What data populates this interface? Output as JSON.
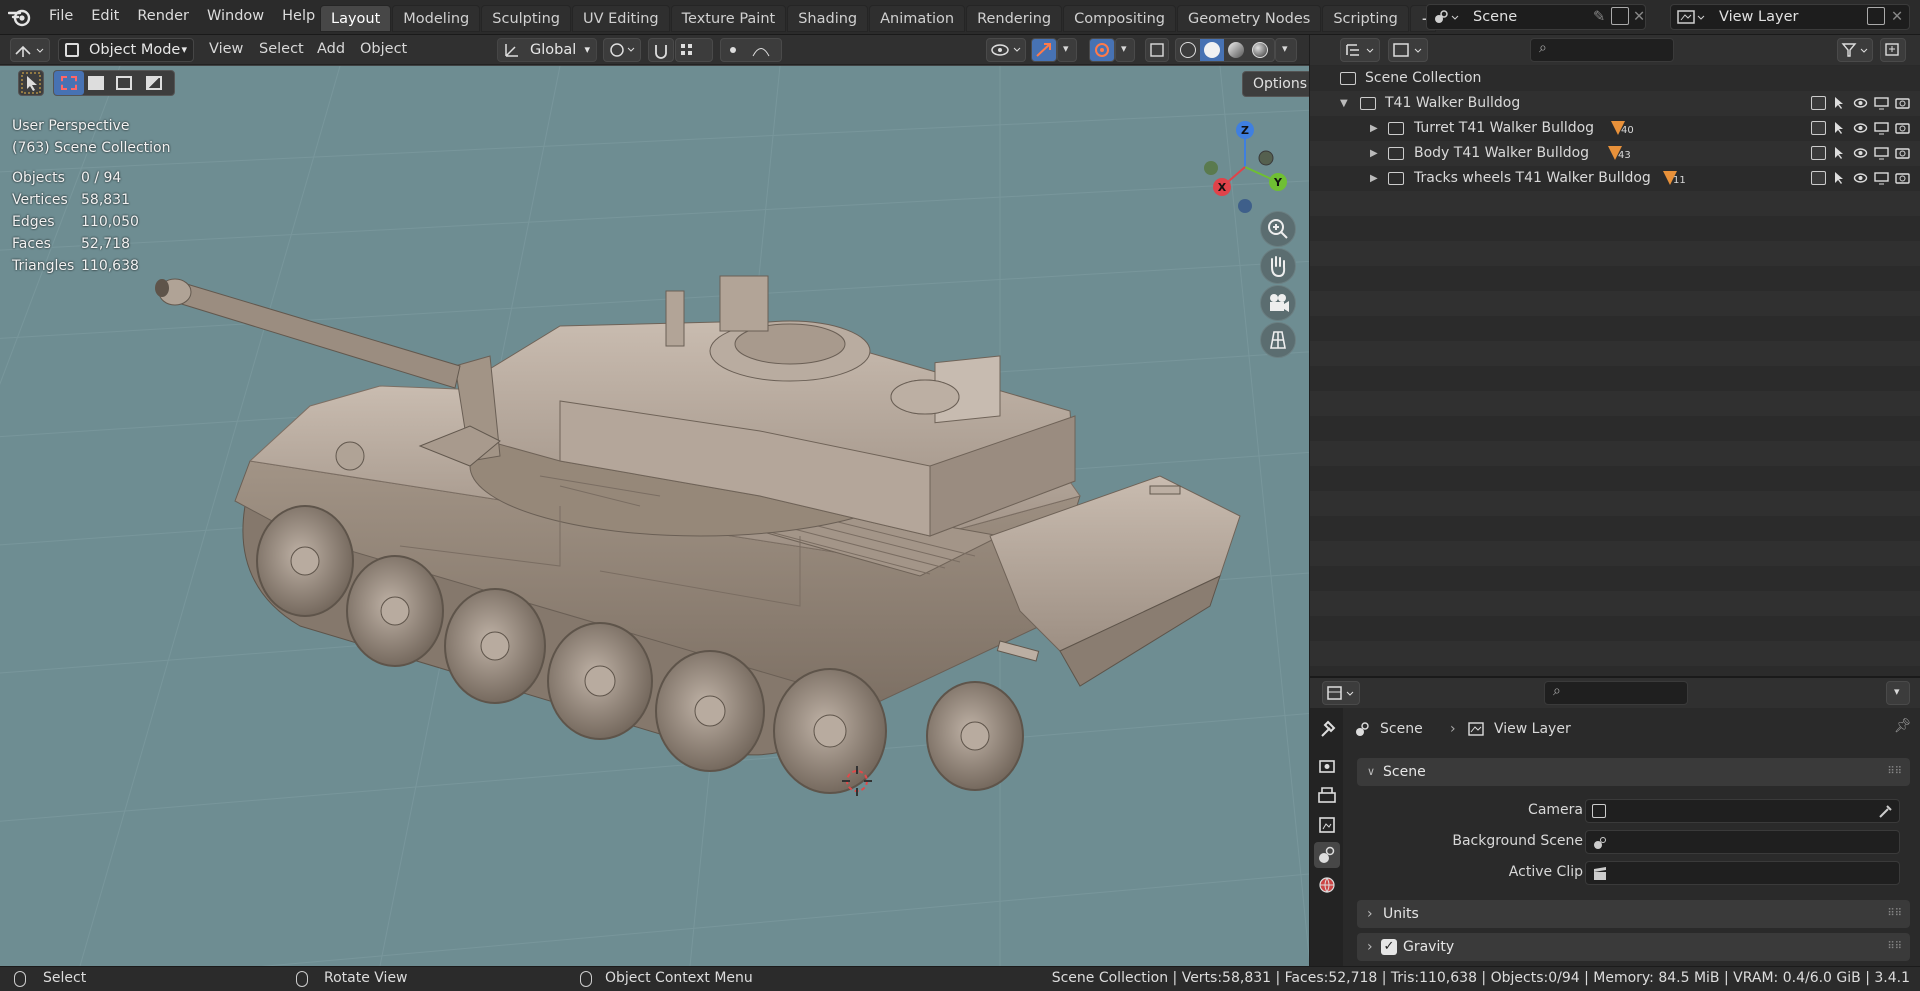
{
  "menu": [
    "File",
    "Edit",
    "Render",
    "Window",
    "Help"
  ],
  "workspaces": [
    "Layout",
    "Modeling",
    "Sculpting",
    "UV Editing",
    "Texture Paint",
    "Shading",
    "Animation",
    "Rendering",
    "Compositing",
    "Geometry Nodes",
    "Scripting"
  ],
  "active_workspace": "Layout",
  "scene_selector": {
    "label": "Scene"
  },
  "view_layer_selector": {
    "label": "View Layer"
  },
  "viewport": {
    "mode": "Object Mode",
    "menus": [
      "View",
      "Select",
      "Add",
      "Object"
    ],
    "orientation": "Global",
    "options_label": "Options",
    "overlay_text": {
      "perspective": "User Perspective",
      "collection": "(763) Scene Collection"
    },
    "stats": [
      {
        "key": "Objects",
        "value": "0 / 94"
      },
      {
        "key": "Vertices",
        "value": "58,831"
      },
      {
        "key": "Edges",
        "value": "110,050"
      },
      {
        "key": "Faces",
        "value": "52,718"
      },
      {
        "key": "Triangles",
        "value": "110,638"
      }
    ],
    "gizmo": {
      "x": "X",
      "y": "Y",
      "z": "Z"
    }
  },
  "outliner": {
    "root": "Scene Collection",
    "collection": "T41 Walker Bulldog",
    "children": [
      {
        "name": "Turret T41 Walker Bulldog",
        "count": "40"
      },
      {
        "name": "Body T41 Walker Bulldog",
        "count": "43"
      },
      {
        "name": "Tracks wheels T41 Walker Bulldog",
        "count": "11"
      }
    ]
  },
  "properties": {
    "breadcrumb": {
      "scene": "Scene",
      "view_layer": "View Layer"
    },
    "panel_scene": "Scene",
    "fields": [
      {
        "label": "Camera"
      },
      {
        "label": "Background Scene"
      },
      {
        "label": "Active Clip"
      }
    ],
    "panel_units": "Units",
    "panel_gravity": "Gravity"
  },
  "statusbar": {
    "select": "Select",
    "rotate": "Rotate View",
    "context": "Object Context Menu",
    "info": "Scene Collection | Verts:58,831 | Faces:52,718 | Tris:110,638 | Objects:0/94 | Memory: 84.5 MiB | VRAM: 0.4/6.0 GiB | 3.4.1"
  },
  "colors": {
    "accent": "#4772b3",
    "viewport_bg": "#6e8d92",
    "model": "#a8998c",
    "x_axis": "#e0434a",
    "y_axis": "#6fbf33",
    "z_axis": "#3f7fe0"
  }
}
